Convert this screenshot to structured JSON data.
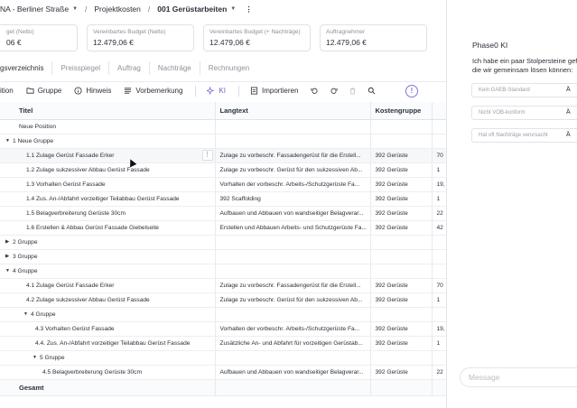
{
  "breadcrumb": {
    "project": "NA - Berliner Straße",
    "section": "Projektkosten",
    "current": "001 Gerüstarbeiten",
    "more": "⋮"
  },
  "cards": [
    {
      "label": "get (Netto)",
      "value": "06 €"
    },
    {
      "label": "Vereinbartes Budget (Netto)",
      "value": "12.479,06 €"
    },
    {
      "label": "Vereinbartes Budget (+ Nachträge)",
      "value": "12.479,06 €"
    },
    {
      "label": "Auftragnehmer",
      "value": "12.479,06 €"
    }
  ],
  "tabs": [
    "gsverzeichnis",
    "Preisspiegel",
    "Auftrag",
    "Nachträge",
    "Rechnungen"
  ],
  "toolbar": {
    "position": "ition",
    "group": "Gruppe",
    "hint": "Hinweis",
    "preface": "Vorbemerkung",
    "ki": "KI",
    "import": "Importieren",
    "alert": "!"
  },
  "table": {
    "headers": [
      "Titel",
      "Langtext",
      "Kostengruppe",
      ""
    ],
    "rows": [
      {
        "title": "Neue Position",
        "lang": "",
        "kg": "",
        "x": "",
        "indent": 0,
        "caret": ""
      },
      {
        "title": "1 Neue Gruppe",
        "lang": "",
        "kg": "",
        "x": "",
        "indent": 0,
        "caret": "down"
      },
      {
        "title": "1.1 Zulage Gerüst Fassade Erker",
        "lang": "Zulage zu vorbeschr. Fassadengerüst für die Erstell...",
        "kg": "392 Gerüste",
        "x": "70",
        "indent": 1,
        "caret": "",
        "hl": true
      },
      {
        "title": "1.2 Zulage sukzessiver Abbau Gerüst Fassade",
        "lang": "Zulage zu vorbeschr. Gerüst für den sukzessiven Ab...",
        "kg": "392 Gerüste",
        "x": "1",
        "indent": 1,
        "caret": ""
      },
      {
        "title": "1.3 Vorhalten Gerüst Fassade",
        "lang": "Vorhalten der vorbeschr. Arbeits-/Schutzgerüste Fa...",
        "kg": "392 Gerüste",
        "x": "19,",
        "indent": 1,
        "caret": ""
      },
      {
        "title": "1.4 Zus. An-/Abfahrt vorzeitiger Teilabbau Gerüst Fassade",
        "lang": "392 Scaffolding",
        "kg": "392 Gerüste",
        "x": "1",
        "indent": 1,
        "caret": ""
      },
      {
        "title": "1.5 Belagverbreiterung Gerüste 30cm",
        "lang": "Aufbauen und Abbauen von wandseitiger Belagverar...",
        "kg": "392 Gerüste",
        "x": "22",
        "indent": 1,
        "caret": ""
      },
      {
        "title": "1.6 Erstellen & Abbau Gerüst Fassade Giebelseite",
        "lang": "Erstellen und Abbauen Arbeits- und Schutzgerüste Fa...",
        "kg": "392 Gerüste",
        "x": "42",
        "indent": 1,
        "caret": ""
      },
      {
        "title": "2 Gruppe",
        "lang": "",
        "kg": "",
        "x": "",
        "indent": 0,
        "caret": "right"
      },
      {
        "title": "3 Gruppe",
        "lang": "",
        "kg": "",
        "x": "",
        "indent": 0,
        "caret": "right"
      },
      {
        "title": "4 Gruppe",
        "lang": "",
        "kg": "",
        "x": "",
        "indent": 0,
        "caret": "down"
      },
      {
        "title": "4.1 Zulage Gerüst Fassade Erker",
        "lang": "Zulage zu vorbeschr. Fassadengerüst für die Erstell...",
        "kg": "392 Gerüste",
        "x": "70",
        "indent": 1,
        "caret": ""
      },
      {
        "title": "4.2 Zulage sukzessiver Abbau Gerüst Fassade",
        "lang": "Zulage zu vorbeschr. Gerüst für den sukzessiven Ab...",
        "kg": "392 Gerüste",
        "x": "1",
        "indent": 1,
        "caret": ""
      },
      {
        "title": "4 Gruppe",
        "lang": "",
        "kg": "",
        "x": "",
        "indent": 1,
        "caret": "down"
      },
      {
        "title": "4.3 Vorhalten Gerüst Fassade",
        "lang": "Vorhalten der vorbeschr. Arbeits-/Schutzgerüste Fa...",
        "kg": "392 Gerüste",
        "x": "19,",
        "indent": 2,
        "caret": ""
      },
      {
        "title": "4.4. Zus. An-/Abfahrt vorzeitiger Teilabbau Gerüst Fassade",
        "lang": "Zusätzliche An- und Abfahrt für vorzeitigen Gerüstab...",
        "kg": "392 Gerüste",
        "x": "1",
        "indent": 2,
        "caret": ""
      },
      {
        "title": "5 Gruppe",
        "lang": "",
        "kg": "",
        "x": "",
        "indent": 2,
        "caret": "down"
      },
      {
        "title": "4.5 Belagverbreiterung Gerüste 30cm",
        "lang": "Aufbauen und Abbauen von wandseitiger Belagverar...",
        "kg": "392 Gerüste",
        "x": "22",
        "indent": 3,
        "caret": ""
      }
    ],
    "total": "Gesamt"
  },
  "chat": {
    "title": "Phase0 KI",
    "message_line1": "Ich habe ein paar Stolpersteine gef",
    "message_line2": "die wir gemeinsam lösen können:",
    "issues": [
      {
        "label": "Kein GAEB-Standard",
        "action": "Ä"
      },
      {
        "label": "Nicht VOB-konform",
        "action": "Ä"
      },
      {
        "label": "Hat oft Nachträge verursacht",
        "action": "Ä"
      }
    ],
    "input_placeholder": "Message"
  }
}
